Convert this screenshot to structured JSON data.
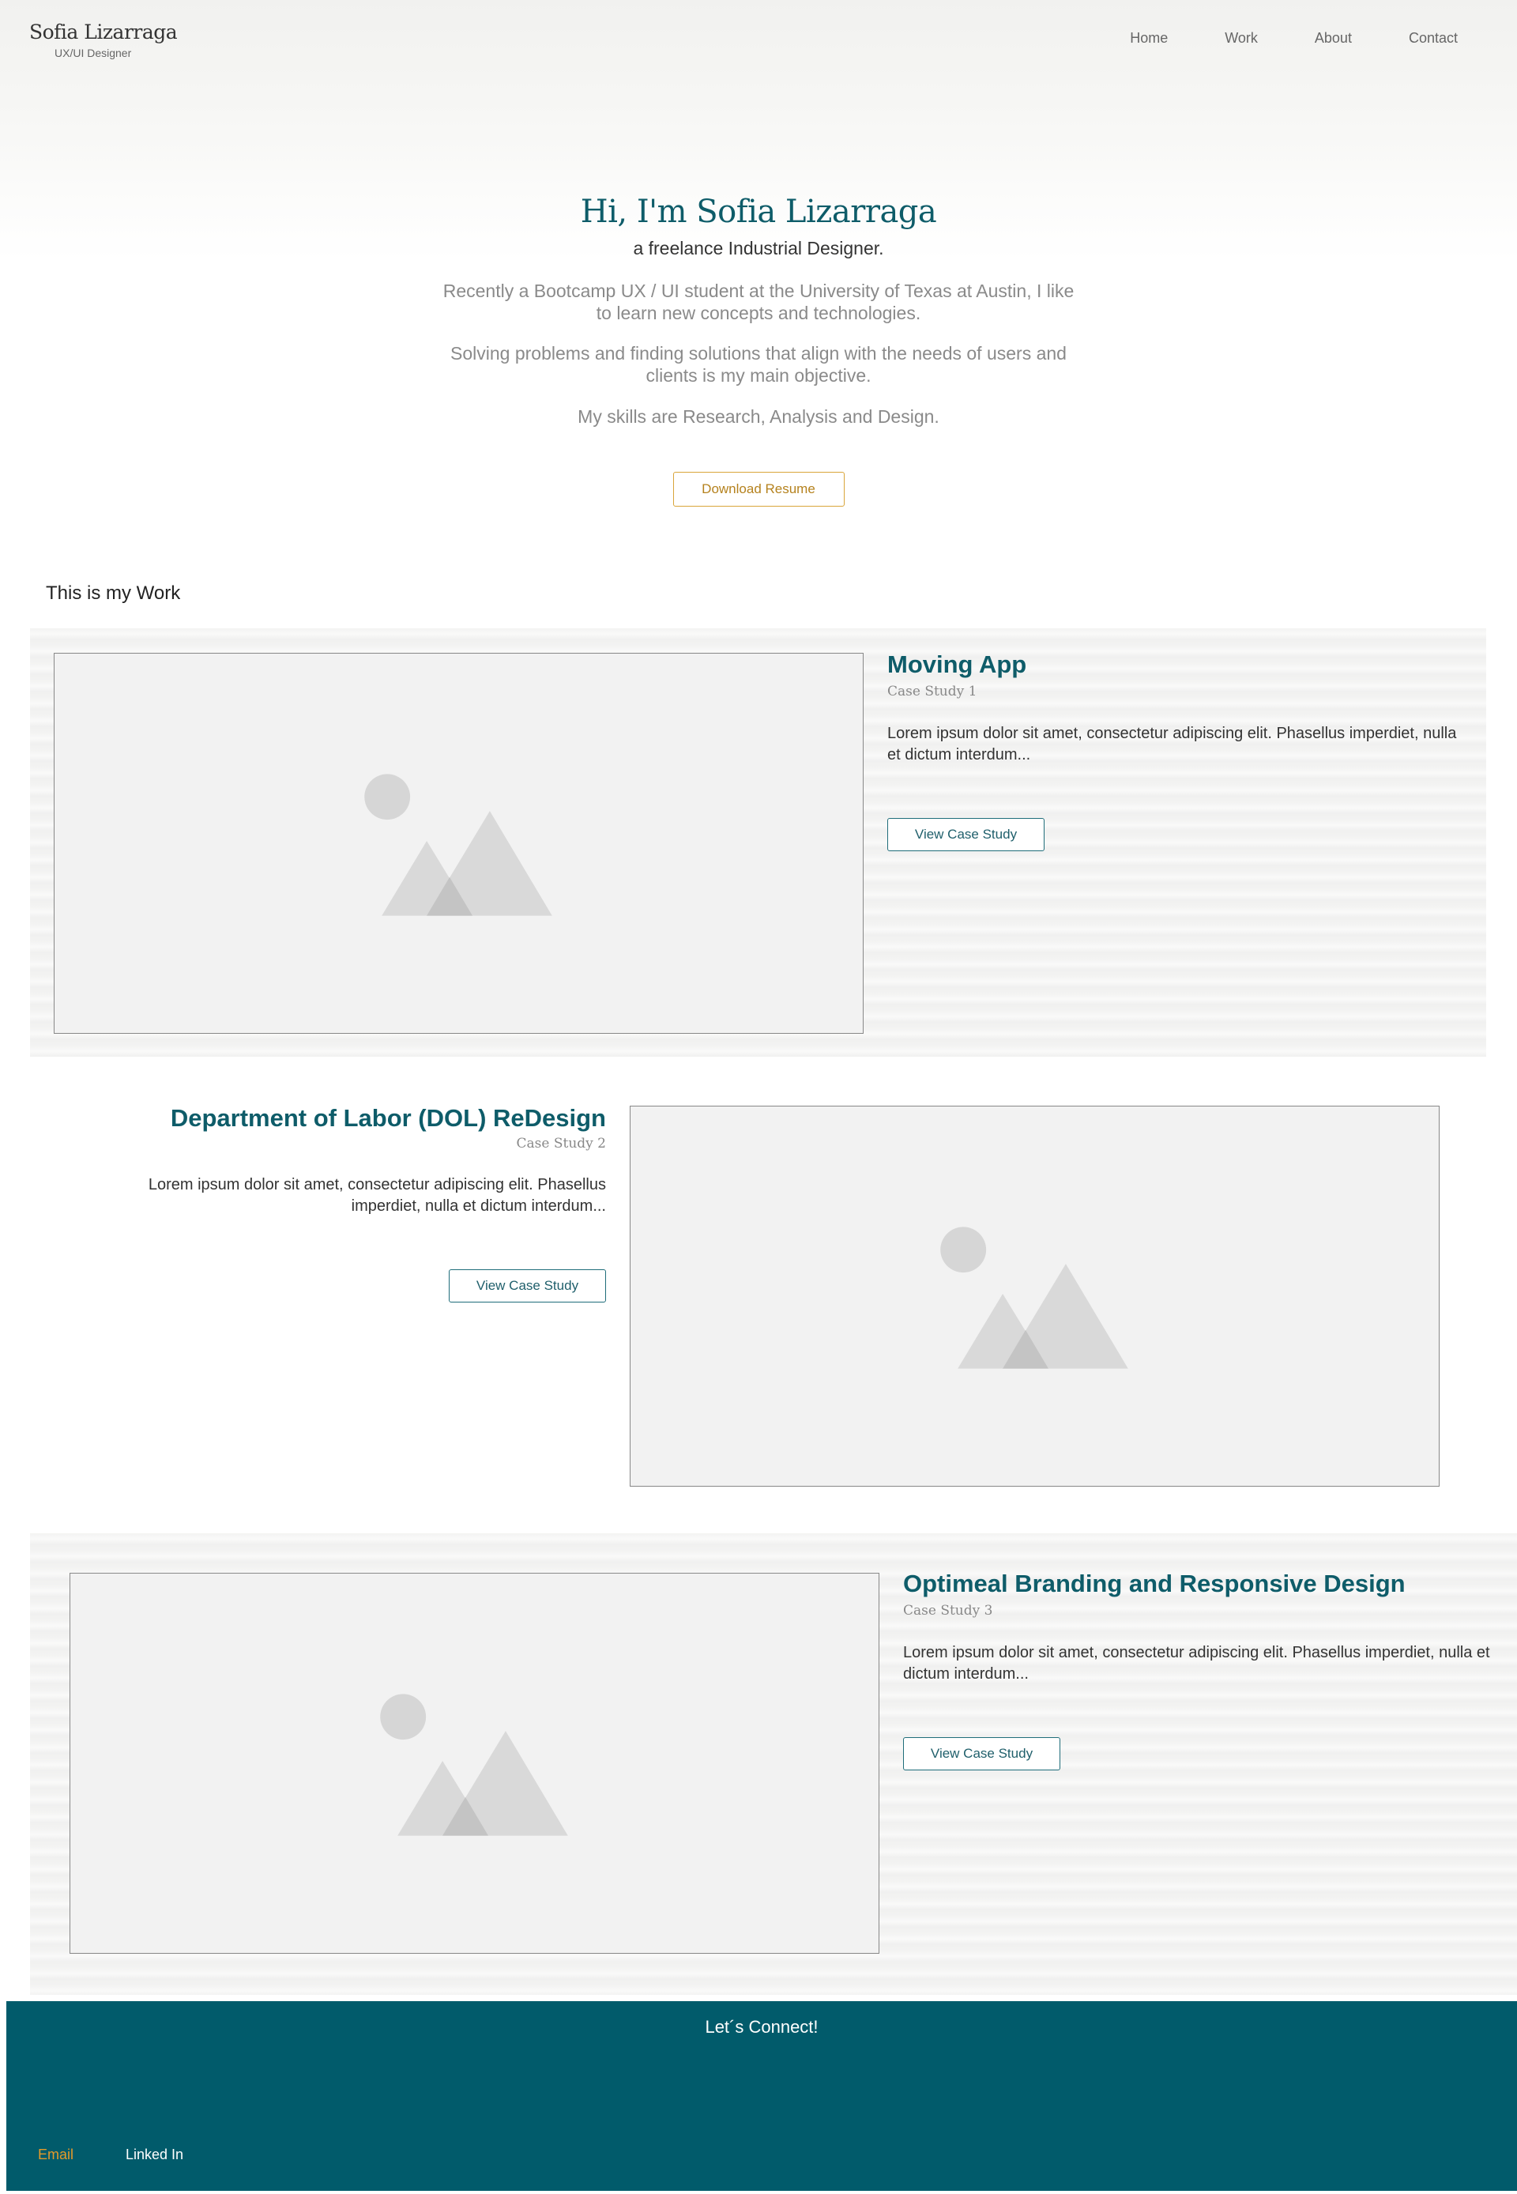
{
  "header": {
    "name": "Sofia Lizarraga",
    "role": "UX/UI Designer",
    "nav": [
      "Home",
      "Work",
      "About",
      "Contact"
    ]
  },
  "hero": {
    "title": "Hi, I'm Sofia Lizarraga",
    "subtitle": "a freelance Industrial Designer.",
    "paragraph1": "Recently a Bootcamp UX / UI student at the University of Texas at Austin, I like to learn new concepts and technologies.",
    "paragraph2": "Solving problems and finding solutions that align with the needs of users and clients is my main objective.",
    "paragraph3": "My skills are Research, Analysis and Design.",
    "resume_button": "Download Resume"
  },
  "work": {
    "heading": "This is my Work",
    "cases": [
      {
        "title": "Moving App",
        "subtitle": "Case Study 1",
        "description": "Lorem ipsum dolor sit amet, consectetur adipiscing elit. Phasellus imperdiet, nulla et dictum interdum...",
        "button": "View Case Study"
      },
      {
        "title": "Department of Labor (DOL) ReDesign",
        "subtitle": "Case Study 2",
        "description": "Lorem ipsum dolor sit amet, consectetur adipiscing elit. Phasellus imperdiet, nulla et dictum interdum...",
        "button": "View Case Study"
      },
      {
        "title": "Optimeal Branding and Responsive Design",
        "subtitle": "Case Study 3",
        "description": "Lorem ipsum dolor sit amet, consectetur adipiscing elit. Phasellus imperdiet, nulla et dictum interdum...",
        "button": "View Case Study"
      }
    ]
  },
  "footer": {
    "title": "Let´s Connect!",
    "email": "Email",
    "linkedin": "Linked In"
  },
  "colors": {
    "accent": "#0e5c69",
    "footer_bg": "#015b6b",
    "resume_border": "#d9a53a",
    "email_link": "#e39a2a"
  },
  "icons": [
    "image-placeholder-icon"
  ]
}
